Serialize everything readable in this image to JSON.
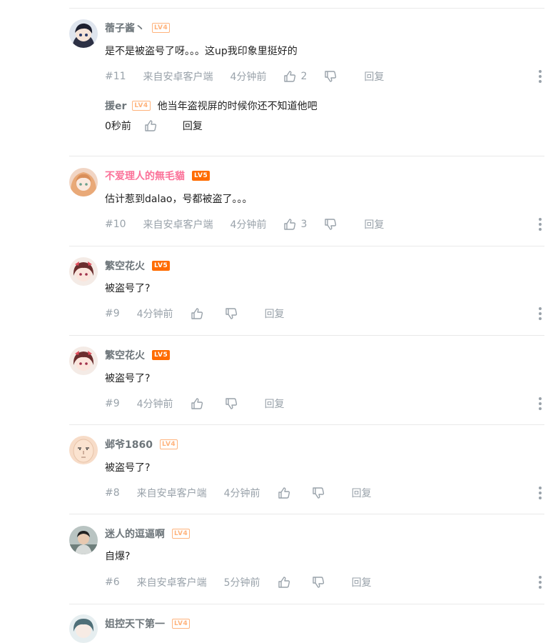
{
  "comments": [
    {
      "username": "蓿子酱丶",
      "level": "LV4",
      "text": "是不是被盗号了呀。。。这up我印象里挺好的",
      "floor": "#11",
      "source": "来自安卓客户端",
      "time": "4分钟前",
      "likes": "2",
      "reply_label": "回复",
      "sub_reply": {
        "username": "援er",
        "level": "LV4",
        "text": "他当年盗视屏的时候你还不知道他吧",
        "time": "0秒前",
        "reply_label": "回复"
      }
    },
    {
      "username": "不爱理人的無毛貓",
      "level": "LV5",
      "text": "估计惹到dalao，号都被盗了。。。",
      "floor": "#10",
      "source": "来自安卓客户端",
      "time": "4分钟前",
      "likes": "3",
      "reply_label": "回复"
    },
    {
      "username": "繁空花火",
      "level": "LV5",
      "text": "被盗号了?",
      "floor": "#9",
      "time": "4分钟前",
      "reply_label": "回复"
    },
    {
      "username": "繁空花火",
      "level": "LV5",
      "text": "被盗号了?",
      "floor": "#9",
      "time": "4分钟前",
      "reply_label": "回复"
    },
    {
      "username": "邺爷1860",
      "level": "LV4",
      "text": "被盗号了?",
      "floor": "#8",
      "source": "来自安卓客户端",
      "time": "4分钟前",
      "reply_label": "回复"
    },
    {
      "username": "迷人的逗逼啊",
      "level": "LV4",
      "text": "自爆?",
      "floor": "#6",
      "source": "来自安卓客户端",
      "time": "5分钟前",
      "reply_label": "回复"
    },
    {
      "username": "姐控天下第一",
      "level": "LV4"
    }
  ],
  "colors": {
    "username_gray": "#6d757a",
    "username_pink": "#fb7299",
    "meta_gray": "#99a2aa",
    "lv4": "#ffb37c",
    "lv5": "#ff6c00"
  },
  "icons": [
    "like-icon",
    "dislike-icon",
    "more-icon"
  ]
}
